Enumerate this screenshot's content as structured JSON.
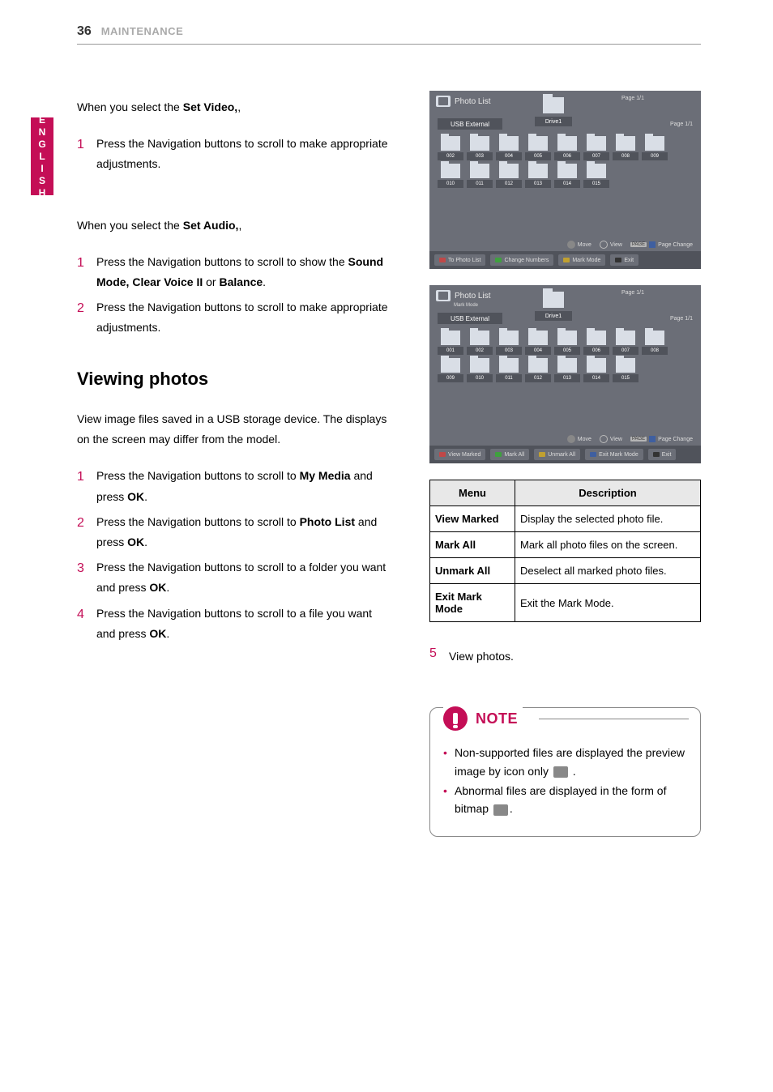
{
  "header": {
    "page_no": "36",
    "section": "MAINTENANCE"
  },
  "lang_tab": "ENGLISH",
  "left": {
    "set_video_intro": {
      "pre": "When you select the ",
      "bold": "Set Video,",
      "post": ","
    },
    "set_video_steps": [
      {
        "n": "1",
        "text": "Press the Navigation buttons to scroll to make appropriate adjustments."
      }
    ],
    "set_audio_intro": {
      "pre": "When you select the ",
      "bold": "Set Audio,",
      "post": ","
    },
    "set_audio_steps": [
      {
        "n": "1",
        "pre": "Press the Navigation buttons to scroll to show the ",
        "bold": "Sound Mode, Clear Voice II",
        "mid": " or ",
        "bold2": "Balance",
        "post": "."
      },
      {
        "n": "2",
        "text": "Press the Navigation buttons to scroll to make appropriate adjustments."
      }
    ],
    "viewing_heading": "Viewing photos",
    "viewing_intro": "View image files saved in a USB storage device. The displays on the screen may differ from the model.",
    "viewing_steps": [
      {
        "n": "1",
        "pre": "Press the Navigation buttons to scroll to ",
        "bold": "My Media",
        "mid": " and press ",
        "bold2": "OK",
        "post": "."
      },
      {
        "n": "2",
        "pre": "Press the Navigation buttons to scroll to ",
        "bold": "Photo List",
        "mid": " and press ",
        "bold2": "OK",
        "post": "."
      },
      {
        "n": "3",
        "pre": "Press the Navigation buttons to scroll to a folder you want and press ",
        "bold": "OK",
        "post": "."
      },
      {
        "n": "4",
        "pre": "Press the Navigation buttons to scroll to a file you want and press ",
        "bold": "OK",
        "post": "."
      }
    ]
  },
  "shot_a": {
    "title": "Photo List",
    "usb": "USB External",
    "drive": "Drive1",
    "page_top": "Page 1/1",
    "page_small": "Page 1/1",
    "thumbs": [
      "002",
      "003",
      "004",
      "005",
      "006",
      "007",
      "008",
      "009",
      "010",
      "011",
      "012",
      "013",
      "014",
      "015"
    ],
    "ctrl": {
      "move": "Move",
      "view": "View",
      "page_label": "PAGE",
      "page_change": "Page Change"
    },
    "buttons": [
      {
        "label": "To Photo List",
        "color": "r"
      },
      {
        "label": "Change Numbers",
        "color": "g"
      },
      {
        "label": "Mark Mode",
        "color": "y"
      },
      {
        "label": "Exit",
        "color": "none"
      }
    ]
  },
  "shot_b": {
    "title": "Photo List",
    "mark_mode": "Mark Mode",
    "usb": "USB External",
    "drive": "Drive1",
    "page_top": "Page 1/1",
    "page_small": "Page 1/1",
    "thumbs": [
      "001",
      "002",
      "003",
      "004",
      "005",
      "006",
      "007",
      "008",
      "009",
      "010",
      "011",
      "012",
      "013",
      "014",
      "015"
    ],
    "ctrl": {
      "move": "Move",
      "view": "View",
      "page_label": "PAGE",
      "page_change": "Page Change"
    },
    "buttons": [
      {
        "label": "View Marked",
        "color": "r"
      },
      {
        "label": "Mark All",
        "color": "g"
      },
      {
        "label": "Unmark All",
        "color": "y"
      },
      {
        "label": "Exit Mark Mode",
        "color": "b"
      },
      {
        "label": "Exit",
        "color": "none"
      }
    ]
  },
  "table": {
    "headers": [
      "Menu",
      "Description"
    ],
    "rows": [
      [
        "View Marked",
        "Display the selected photo file."
      ],
      [
        "Mark All",
        "Mark all photo files on the screen."
      ],
      [
        "Unmark All",
        "Deselect all marked photo files."
      ],
      [
        "Exit Mark Mode",
        "Exit the Mark Mode."
      ]
    ]
  },
  "step5": {
    "n": "5",
    "text": "View photos."
  },
  "note": {
    "title": "NOTE",
    "items": [
      {
        "a": "Non-supported files are displayed the preview image by icon only ",
        "b": " ."
      },
      {
        "a": "Abnormal files are displayed in the form of bitmap ",
        "b": "."
      }
    ]
  }
}
